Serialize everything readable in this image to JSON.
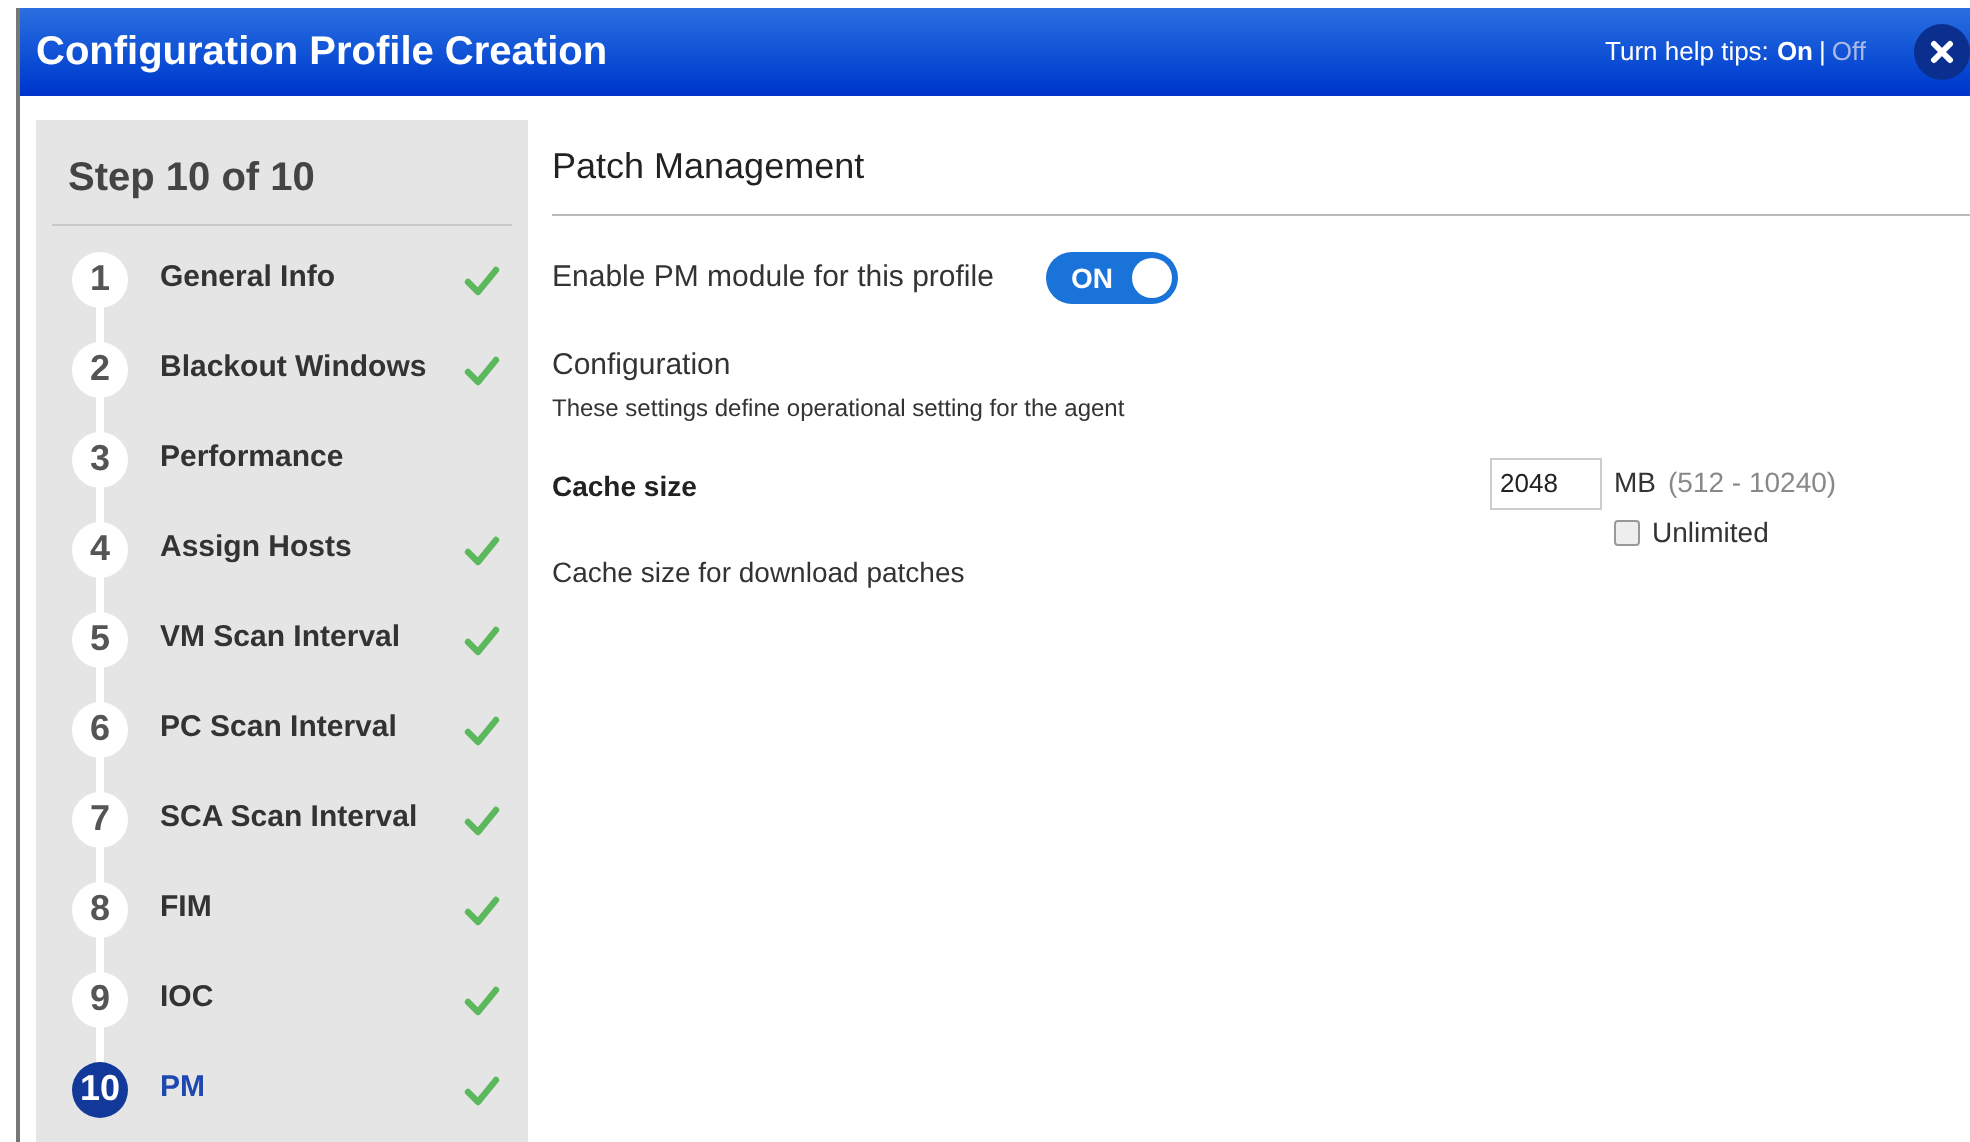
{
  "window": {
    "title": "Configuration Profile Creation"
  },
  "help_tips": {
    "label": "Turn help tips:",
    "options": [
      {
        "label": "On",
        "selected": true
      },
      {
        "label": "Off",
        "selected": false
      }
    ],
    "separator": "|"
  },
  "sidebar": {
    "heading": "Step 10 of 10",
    "steps": [
      {
        "number": "1",
        "label": "General Info",
        "completed": true,
        "selected": false
      },
      {
        "number": "2",
        "label": "Blackout Windows",
        "completed": true,
        "selected": false
      },
      {
        "number": "3",
        "label": "Performance",
        "completed": false,
        "selected": false
      },
      {
        "number": "4",
        "label": "Assign Hosts",
        "completed": true,
        "selected": false
      },
      {
        "number": "5",
        "label": "VM Scan Interval",
        "completed": true,
        "selected": false
      },
      {
        "number": "6",
        "label": "PC Scan Interval",
        "completed": true,
        "selected": false
      },
      {
        "number": "7",
        "label": "SCA Scan Interval",
        "completed": true,
        "selected": false
      },
      {
        "number": "8",
        "label": "FIM",
        "completed": true,
        "selected": false
      },
      {
        "number": "9",
        "label": "IOC",
        "completed": true,
        "selected": false
      },
      {
        "number": "10",
        "label": "PM",
        "completed": true,
        "selected": true
      }
    ]
  },
  "content": {
    "title": "Patch Management",
    "enable": {
      "label": "Enable PM module for this profile",
      "toggle_text": "ON",
      "on": true
    },
    "section": {
      "title": "Configuration",
      "description": "These settings define operational setting for the agent"
    },
    "cache": {
      "label": "Cache size",
      "description": "Cache size for download patches",
      "value": "2048",
      "unit": "MB",
      "range": "(512 - 10240)",
      "unlimited": {
        "label": "Unlimited",
        "checked": false
      }
    }
  }
}
